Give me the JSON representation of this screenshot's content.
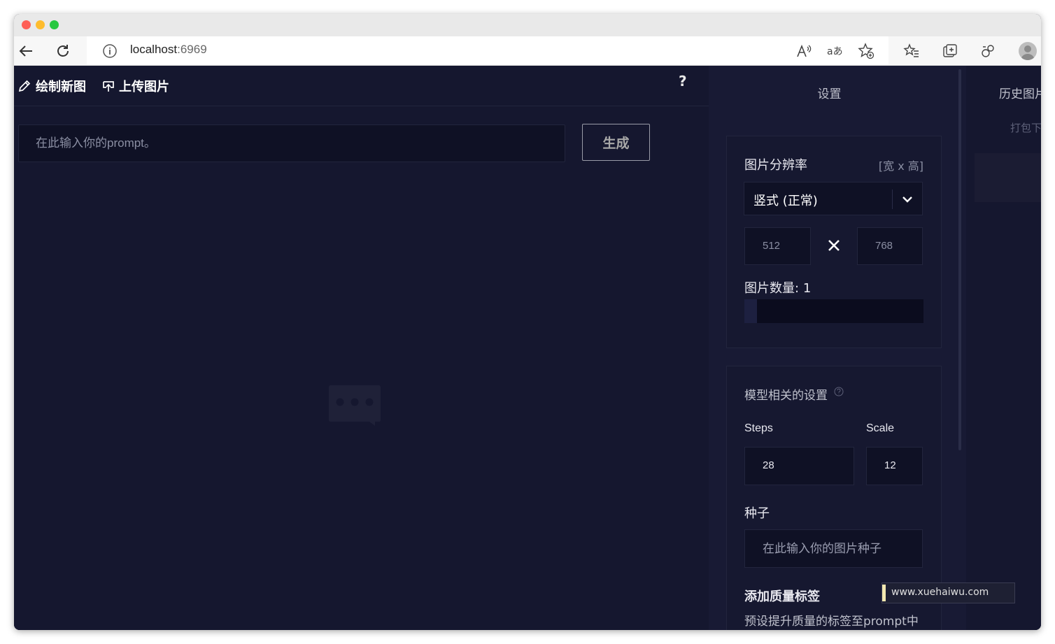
{
  "browser": {
    "url_host": "localhost",
    "url_port": ":6969"
  },
  "tabs": {
    "draw_label": "绘制新图",
    "upload_label": "上传图片",
    "help": "?"
  },
  "prompt": {
    "placeholder": "在此输入你的prompt。",
    "generate_label": "生成"
  },
  "settings": {
    "title": "设置",
    "resolution": {
      "label": "图片分辨率",
      "hint": "[宽 x 高]",
      "selected": "竖式 (正常)",
      "width": "512",
      "height": "768"
    },
    "count": {
      "label": "图片数量:",
      "value": "1",
      "fill_fraction": 0.07
    },
    "model": {
      "title": "模型相关的设置",
      "steps_label": "Steps",
      "steps_value": "28",
      "scale_label": "Scale",
      "scale_value": "12",
      "seed_label": "种子",
      "seed_placeholder": "在此输入你的图片种子",
      "quality_title": "添加质量标签",
      "quality_desc": "预设提升质量的标签至prompt中"
    }
  },
  "history": {
    "title": "历史图片",
    "subtitle": "打包下载"
  },
  "watermark": "www.xuehaiwu.com",
  "colors": {
    "app_bg": "#15172f",
    "panel_bg": "#181a34",
    "input_bg": "#0f1125"
  }
}
